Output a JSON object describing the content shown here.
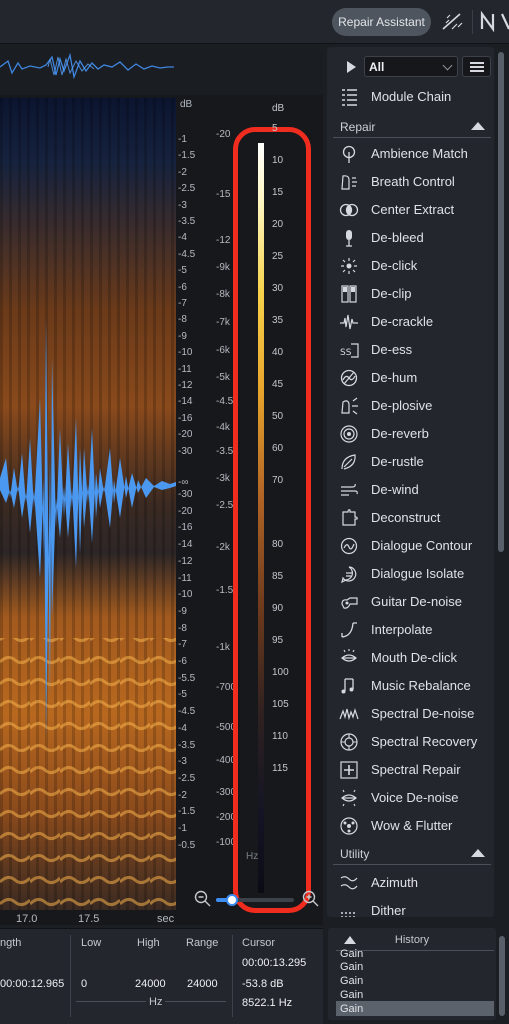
{
  "topbar": {
    "repair_assistant": "Repair Assistant",
    "wand_icon": "wand-icon",
    "logo_icon": "ni-logo-icon"
  },
  "db_scale": {
    "header": "dB",
    "ticks_upper": [
      "-1",
      "-1.5",
      "-2",
      "-2.5",
      "-3",
      "-3.5",
      "-4",
      "-4.5",
      "-5",
      "-6",
      "-7",
      "-8",
      "-9",
      "-10",
      "-11",
      "-12",
      "-14",
      "-16",
      "-20",
      "-30"
    ],
    "infinity": "-∞",
    "ticks_lower": [
      "-30",
      "-20",
      "-16",
      "-14",
      "-12",
      "-11",
      "-10",
      "-9",
      "-8",
      "-7",
      "-6",
      "-5.5",
      "-5",
      "-4.5",
      "-4",
      "-3.5",
      "-3",
      "-2.5",
      "-2",
      "-1.5",
      "-1",
      "-0.5"
    ]
  },
  "hz_scale": {
    "ticks": [
      "-20",
      "-15",
      "-12",
      "-9k",
      "-8k",
      "-7k",
      "-6k",
      "-5k",
      "-4.5",
      "-4k",
      "-3.5",
      "-3k",
      "-2.5",
      "-2k",
      "-1.5",
      "-1k",
      "-700",
      "-500",
      "-400",
      "-300",
      "-200",
      "-100"
    ],
    "cut_label": "Hz"
  },
  "meter": {
    "header": "dB",
    "ticks": [
      "5",
      "10",
      "15",
      "20",
      "25",
      "30",
      "35",
      "40",
      "45",
      "50",
      "60",
      "70",
      "80",
      "85",
      "90",
      "95",
      "100",
      "105",
      "110",
      "115"
    ]
  },
  "time_axis": {
    "ticks": [
      "17.0",
      "17.5"
    ],
    "unit": "sec"
  },
  "zoom": {
    "zoom_out_icon": "zoom-out-icon",
    "zoom_in_icon": "zoom-in-icon",
    "level": 0.18
  },
  "panel": {
    "filter_value": "All",
    "module_chain": "Module Chain",
    "repair_section": "Repair",
    "modules": [
      {
        "label": "Ambience Match",
        "icon": "ambience-match-icon"
      },
      {
        "label": "Breath Control",
        "icon": "breath-control-icon"
      },
      {
        "label": "Center Extract",
        "icon": "center-extract-icon"
      },
      {
        "label": "De-bleed",
        "icon": "de-bleed-icon"
      },
      {
        "label": "De-click",
        "icon": "de-click-icon"
      },
      {
        "label": "De-clip",
        "icon": "de-clip-icon"
      },
      {
        "label": "De-crackle",
        "icon": "de-crackle-icon"
      },
      {
        "label": "De-ess",
        "icon": "de-ess-icon"
      },
      {
        "label": "De-hum",
        "icon": "de-hum-icon"
      },
      {
        "label": "De-plosive",
        "icon": "de-plosive-icon"
      },
      {
        "label": "De-reverb",
        "icon": "de-reverb-icon"
      },
      {
        "label": "De-rustle",
        "icon": "de-rustle-icon"
      },
      {
        "label": "De-wind",
        "icon": "de-wind-icon"
      },
      {
        "label": "Deconstruct",
        "icon": "deconstruct-icon"
      },
      {
        "label": "Dialogue Contour",
        "icon": "dialogue-contour-icon"
      },
      {
        "label": "Dialogue Isolate",
        "icon": "dialogue-isolate-icon"
      },
      {
        "label": "Guitar De-noise",
        "icon": "guitar-de-noise-icon"
      },
      {
        "label": "Interpolate",
        "icon": "interpolate-icon"
      },
      {
        "label": "Mouth De-click",
        "icon": "mouth-de-click-icon"
      },
      {
        "label": "Music Rebalance",
        "icon": "music-rebalance-icon"
      },
      {
        "label": "Spectral De-noise",
        "icon": "spectral-de-noise-icon"
      },
      {
        "label": "Spectral Recovery",
        "icon": "spectral-recovery-icon"
      },
      {
        "label": "Spectral Repair",
        "icon": "spectral-repair-icon"
      },
      {
        "label": "Voice De-noise",
        "icon": "voice-de-noise-icon"
      },
      {
        "label": "Wow & Flutter",
        "icon": "wow-flutter-icon"
      }
    ],
    "utility_section": "Utility",
    "utility_modules": [
      {
        "label": "Azimuth",
        "icon": "azimuth-icon"
      },
      {
        "label": "Dither",
        "icon": "dither-icon"
      }
    ]
  },
  "info": {
    "length_header": "ngth",
    "length_value": "00:00:12.965",
    "low_header": "Low",
    "low_value": "0",
    "high_header": "High",
    "high_value": "24000",
    "range_header": "Range",
    "range_value": "24000",
    "hz_label": "Hz",
    "cursor_header": "Cursor",
    "cursor_time": "00:00:13.295",
    "cursor_db": "-53.8 dB",
    "cursor_hz": "8522.1 Hz"
  },
  "history": {
    "title": "History",
    "items": [
      "Gain",
      "Gain",
      "Gain",
      "Gain",
      "Gain"
    ]
  },
  "colors": {
    "accent": "#3d8cf0",
    "highlight": "#f02c1e",
    "waveform": "#4a98f0"
  }
}
